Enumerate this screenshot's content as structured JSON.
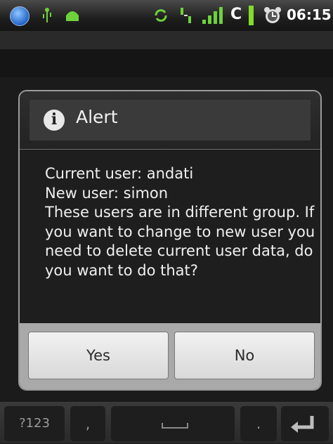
{
  "status_bar": {
    "carrier": "C",
    "time": "06:15",
    "icons": [
      "wifi-icon",
      "usb-icon",
      "android-icon",
      "sync-icon",
      "data-icon",
      "signal-icon",
      "battery-icon",
      "alarm-icon"
    ],
    "battery_color": "#7fdc2c"
  },
  "dialog": {
    "title": "Alert",
    "icon": "info-icon",
    "info_glyph": "i",
    "message": "Current user: andati\nNew user: simon\nThese users are in different group. If you want to change to new user you need to delete current user data, do you want to do that?",
    "buttons": {
      "yes": "Yes",
      "no": "No"
    }
  },
  "keyboard": {
    "symbols_key": "?123",
    "comma_key": ",",
    "period_key": "."
  }
}
